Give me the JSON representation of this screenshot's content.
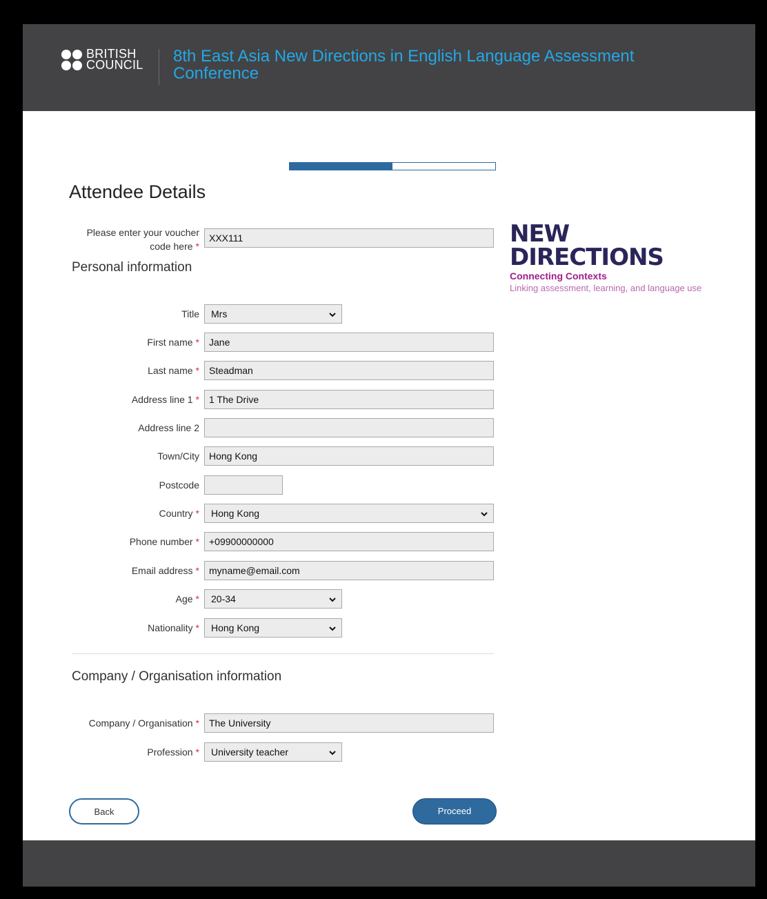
{
  "header": {
    "logo_line1": "BRITISH",
    "logo_line2": "COUNCIL",
    "conference_title": "8th East Asia New Directions in English Language Assessment Conference"
  },
  "progress": {
    "fraction": 0.5
  },
  "page_title": "Attendee Details",
  "voucher": {
    "label": "Please enter your voucher code here",
    "required_mark": "*",
    "value": "XXX111"
  },
  "personal": {
    "section_title": "Personal information",
    "title": {
      "label": "Title",
      "value": "Mrs"
    },
    "first_name": {
      "label": "First name",
      "value": "Jane"
    },
    "last_name": {
      "label": "Last name",
      "value": "Steadman"
    },
    "address1": {
      "label": "Address line 1",
      "value": "1 The Drive"
    },
    "address2": {
      "label": "Address line 2",
      "value": ""
    },
    "town": {
      "label": "Town/City",
      "value": "Hong Kong"
    },
    "postcode": {
      "label": "Postcode",
      "value": ""
    },
    "country": {
      "label": "Country",
      "value": "Hong Kong"
    },
    "phone": {
      "label": "Phone number",
      "value": "+09900000000"
    },
    "email": {
      "label": "Email address",
      "value": "myname@email.com"
    },
    "age": {
      "label": "Age",
      "value": "20-34"
    },
    "nationality": {
      "label": "Nationality",
      "value": "Hong Kong"
    }
  },
  "company": {
    "section_title": "Company / Organisation information",
    "organisation": {
      "label": "Company / Organisation",
      "value": "The University"
    },
    "profession": {
      "label": "Profession",
      "value": "University teacher"
    }
  },
  "required_mark": "*",
  "buttons": {
    "back": "Back",
    "proceed": "Proceed"
  },
  "brand": {
    "line1": "NEW",
    "line2": "DIRECTIONS",
    "tagline1": "Connecting Contexts",
    "tagline2": "Linking assessment, learning, and language use"
  },
  "colors": {
    "header_bg": "#434345",
    "title_blue": "#23a8e6",
    "accent": "#2e6a9e",
    "required": "#d1343a"
  }
}
